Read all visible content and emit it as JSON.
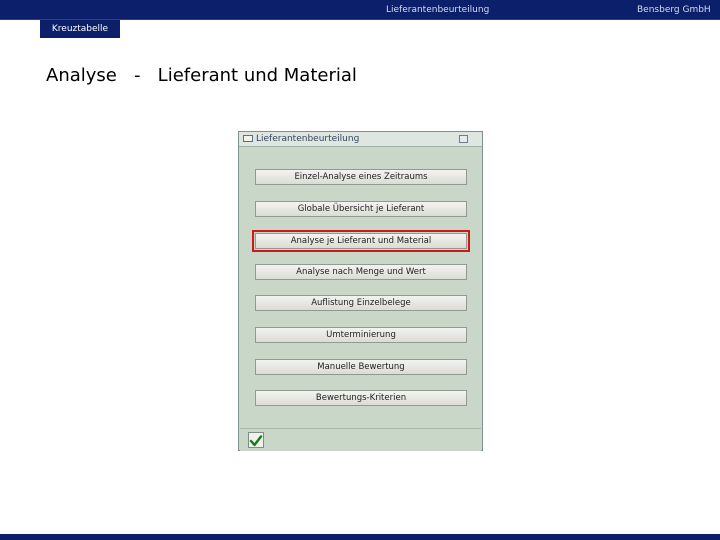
{
  "header": {
    "center_text": "Lieferantenbeurteilung",
    "right_text": "Bensberg GmbH"
  },
  "tag": {
    "label": "Kreuztabelle"
  },
  "page": {
    "title": "Analyse   -   Lieferant und Material"
  },
  "dialog": {
    "title": "Lieferantenbeurteilung",
    "icons": {
      "title": "folder-icon",
      "close": "close-icon",
      "ok": "checkmark-icon"
    },
    "buttons": [
      {
        "label": "Einzel-Analyse eines Zeitraums"
      },
      {
        "label": "Globale Übersicht je Lieferant"
      },
      {
        "label": "Analyse je Lieferant und Material"
      },
      {
        "label": "Analyse nach Menge und Wert"
      },
      {
        "label": "Auflistung Einzelbelege"
      },
      {
        "label": "Umterminierung"
      },
      {
        "label": "Manuelle Bewertung"
      },
      {
        "label": "Bewertungs-Kriterien"
      }
    ],
    "highlighted_index": 2
  },
  "colors": {
    "bar": "#0b1f6b",
    "dialog_bg": "#c8d7c7",
    "highlight": "#d41616"
  }
}
